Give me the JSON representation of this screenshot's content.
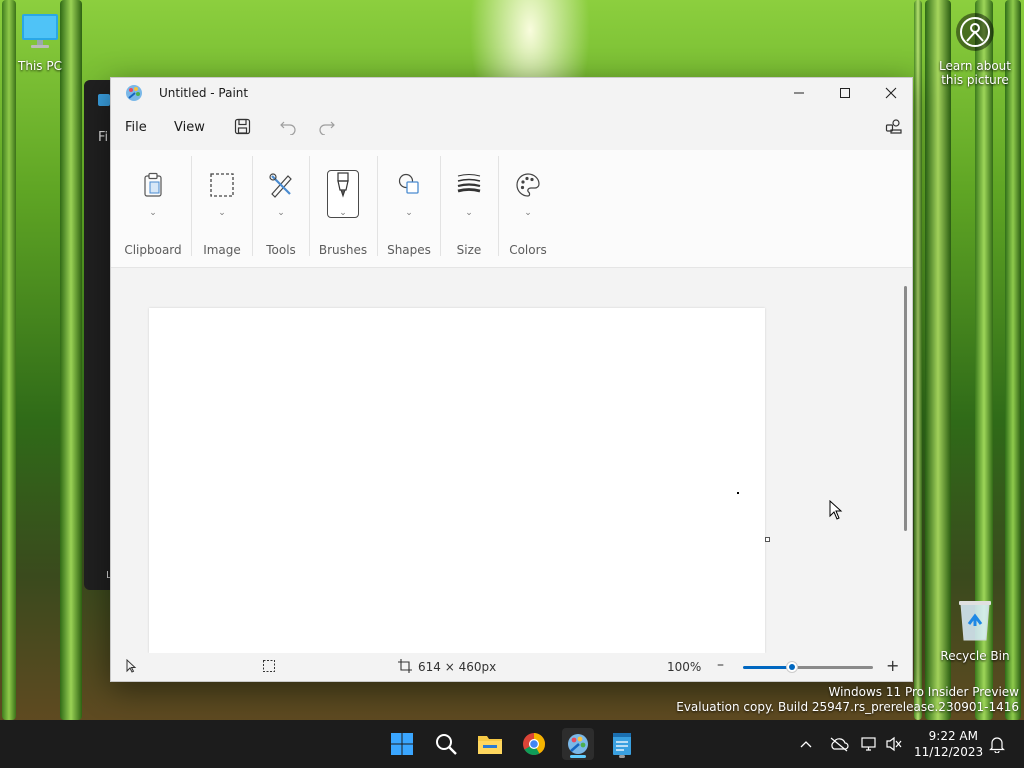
{
  "desktop": {
    "this_pc_label": "This PC",
    "learn_label_line1": "Learn about",
    "learn_label_line2": "this picture",
    "recycle_bin_label": "Recycle Bin",
    "bg_window_text_top": "Fi",
    "bg_window_text_bottom": "L"
  },
  "window": {
    "title": "Untitled - Paint"
  },
  "menu": {
    "file_label": "File",
    "view_label": "View"
  },
  "ribbon": {
    "groups": [
      {
        "label": "Clipboard",
        "icon": "clipboard-icon"
      },
      {
        "label": "Image",
        "icon": "selection-icon"
      },
      {
        "label": "Tools",
        "icon": "tools-icon"
      },
      {
        "label": "Brushes",
        "icon": "brush-icon"
      },
      {
        "label": "Shapes",
        "icon": "shapes-icon"
      },
      {
        "label": "Size",
        "icon": "size-icon"
      },
      {
        "label": "Colors",
        "icon": "palette-icon"
      }
    ]
  },
  "status": {
    "canvas_size": "614 × 460px",
    "zoom_level": "100%",
    "zoom_fraction": 0.38
  },
  "watermark": {
    "line1": "Windows 11 Pro Insider Preview",
    "line2": "Evaluation copy. Build 25947.rs_prerelease.230901-1416"
  },
  "taskbar": {
    "time": "9:22 AM",
    "date": "11/12/2023"
  },
  "colors": {
    "accent": "#0067c0",
    "taskbar_bg": "#1c1c1c",
    "active_indicator": "#60cdff"
  }
}
